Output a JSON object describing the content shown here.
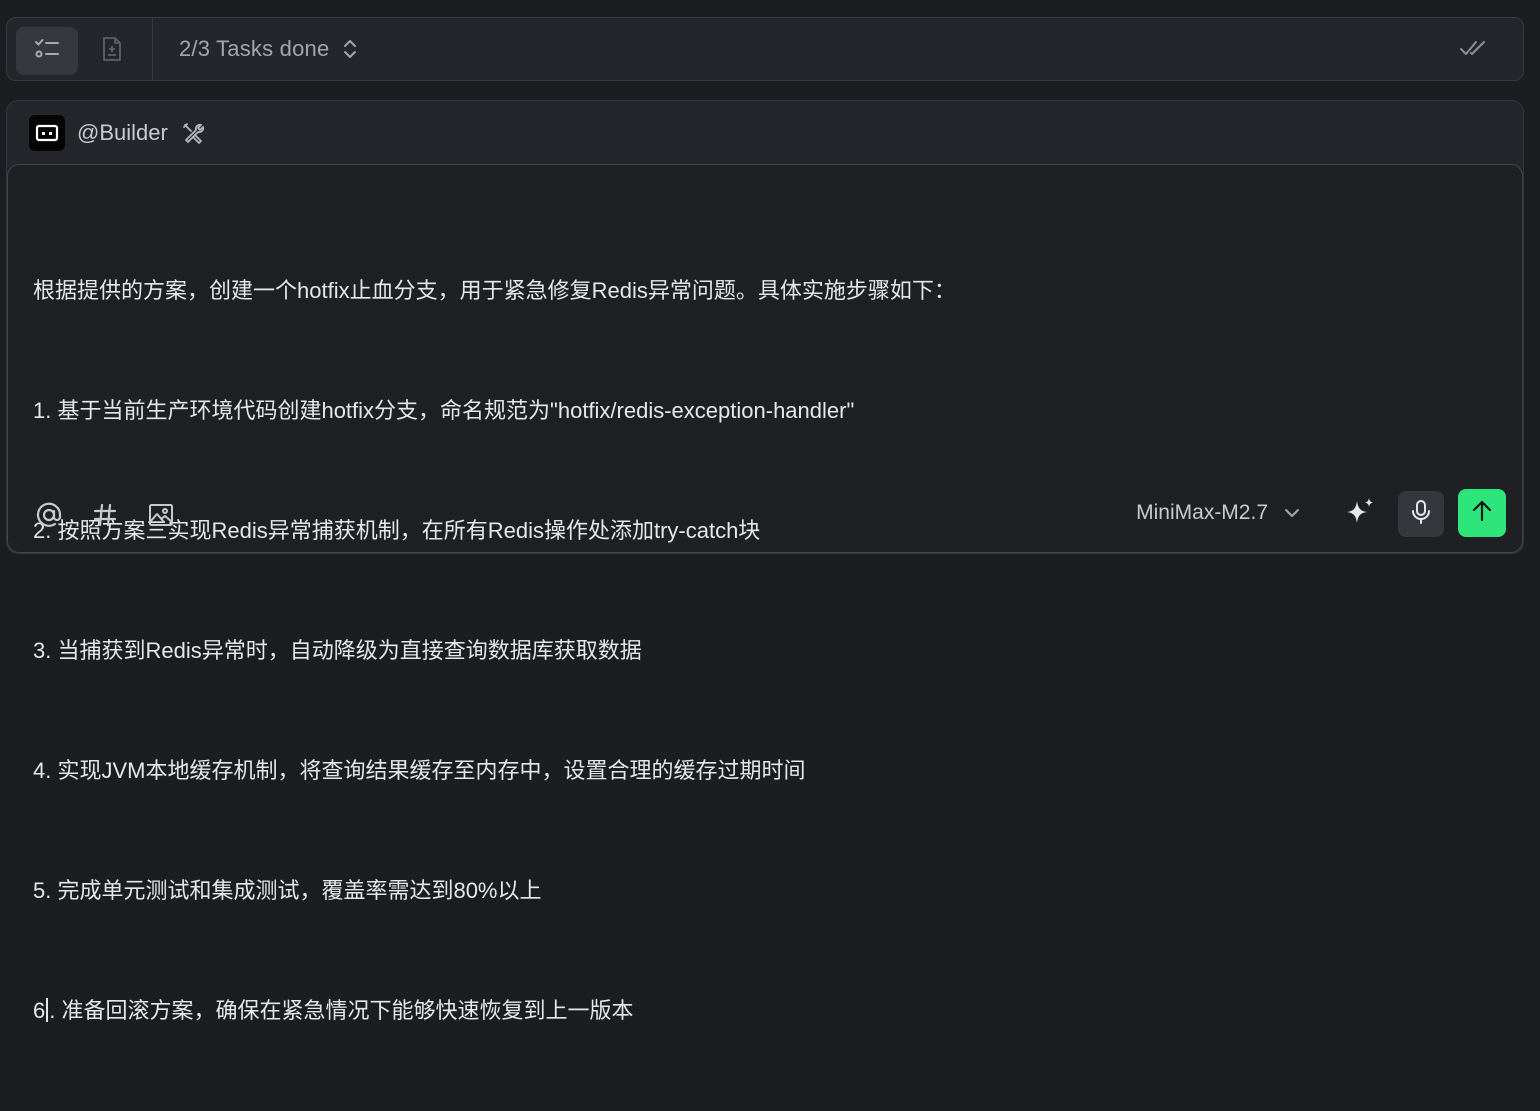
{
  "taskbar": {
    "status_label": "2/3 Tasks done",
    "icons": [
      "checklist-icon",
      "add-file-icon",
      "sort-chevron-icon",
      "check-all-icon"
    ]
  },
  "agent": {
    "name": "@Builder",
    "icons": [
      "robot-avatar-icon",
      "tools-icon"
    ]
  },
  "prompt": {
    "lines": [
      "根据提供的方案，创建一个hotfix止血分支，用于紧急修复Redis异常问题。具体实施步骤如下：",
      "1. 基于当前生产环境代码创建hotfix分支，命名规范为\"hotfix/redis-exception-handler\"",
      "2. 按照方案三实现Redis异常捕获机制，在所有Redis操作处添加try-catch块",
      "3. 当捕获到Redis异常时，自动降级为直接查询数据库获取数据",
      "4. 实现JVM本地缓存机制，将查询结果缓存至内存中，设置合理的缓存过期时间",
      "5. 完成单元测试和集成测试，覆盖率需达到80%以上"
    ],
    "last_line_prefix": "6",
    "last_line_rest": ". 准备回滚方案，确保在紧急情况下能够快速恢复到上一版本"
  },
  "toolbar": {
    "model": "MiniMax-M2.7",
    "icons": [
      "mention-icon",
      "hashtag-icon",
      "image-icon",
      "sparkle-icon",
      "microphone-icon",
      "send-arrow-icon"
    ]
  },
  "colors": {
    "background": "#1c1d21",
    "panel": "#25262b",
    "input": "#1f2024",
    "send_button": "#2ee57b"
  }
}
